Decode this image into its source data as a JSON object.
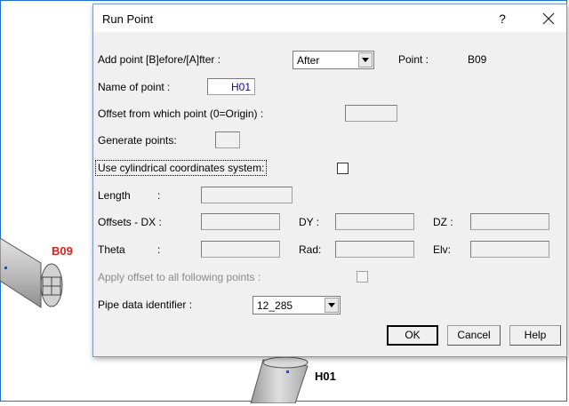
{
  "background": {
    "pipe_labels": [
      "B09",
      "H01"
    ]
  },
  "dialog": {
    "title": "Run Point",
    "help_glyph": "?",
    "add_point_label": "Add point [B]efore/[A]fter :",
    "add_point_value": "After",
    "point_label": "Point :",
    "point_value": "B09",
    "name_label": "Name of point :",
    "name_value": "H01",
    "offset_from_label": "Offset from which point (0=Origin) :",
    "generate_label": "Generate points:",
    "cylindrical_label": "Use cylindrical coordinates system:",
    "length_label": "Length",
    "length_colon": ":",
    "offsets_dx_label": "Offsets - DX :",
    "dy_label": "DY :",
    "dz_label": "DZ :",
    "theta_label": "Theta",
    "theta_colon": ":",
    "rad_label": "Rad:",
    "elv_label": "Elv:",
    "apply_offset_label": "Apply offset to all following points :",
    "pipe_id_label": "Pipe data identifier :",
    "pipe_id_value": "12_285",
    "buttons": {
      "ok": "OK",
      "cancel": "Cancel",
      "help": "Help"
    }
  },
  "colors": {
    "frame_accent": "#1f6fd1",
    "b09_label": "#e0201a",
    "field_value": "#0000c8",
    "pipe_body": "#c8c8c8"
  }
}
